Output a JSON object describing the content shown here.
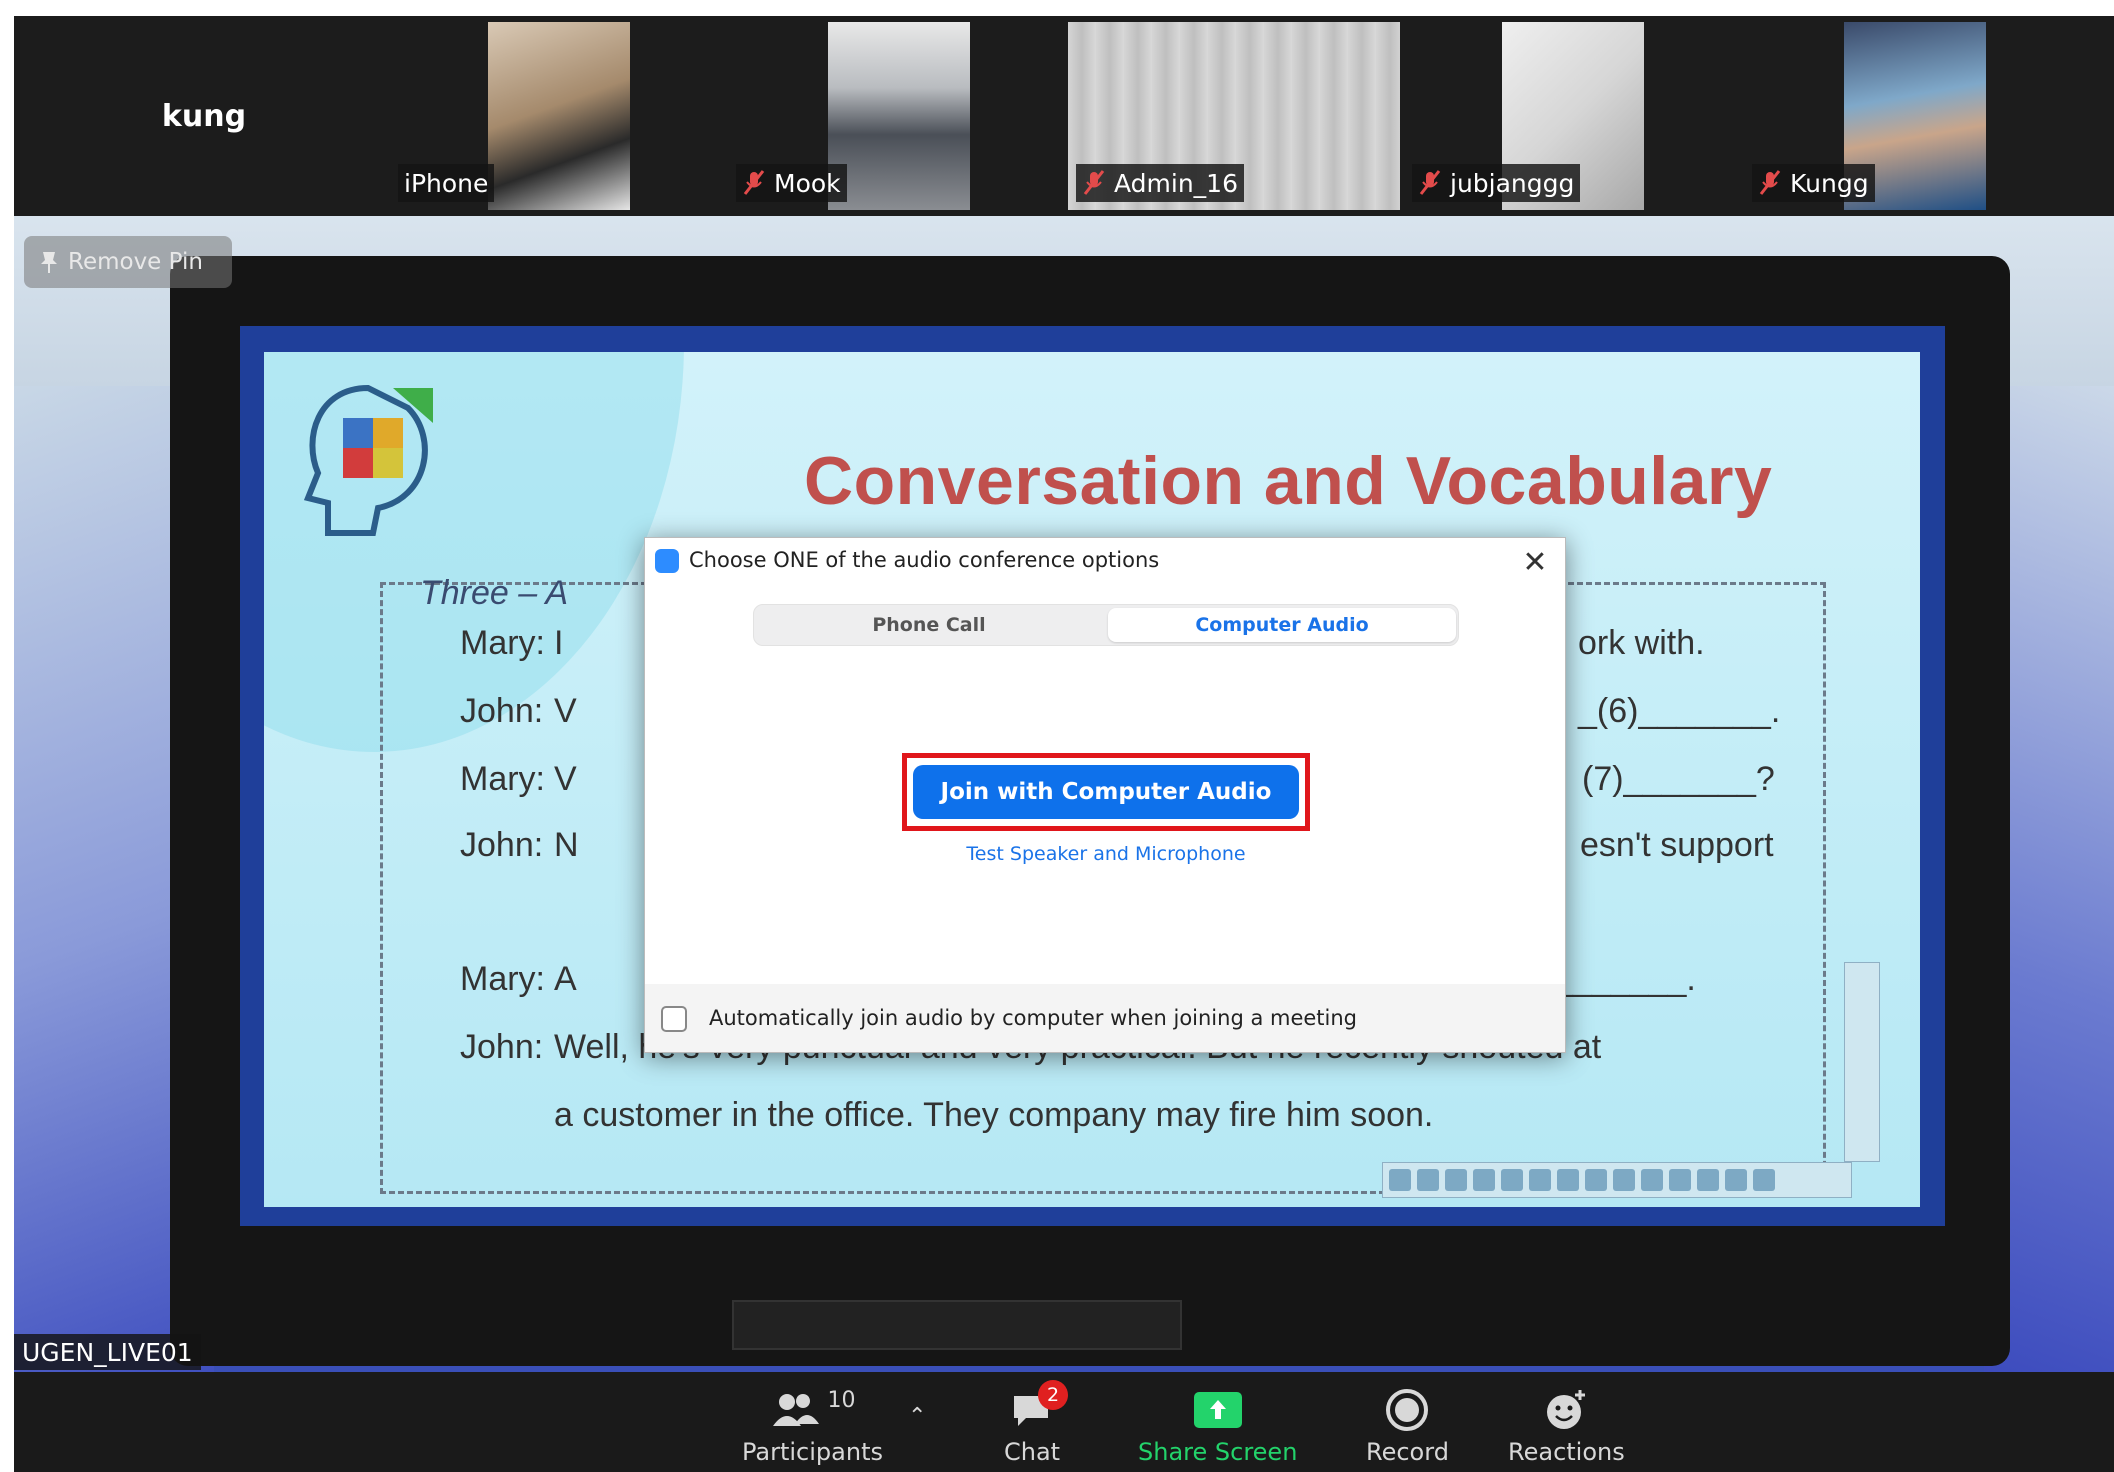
{
  "strip": {
    "name_tile": "kung",
    "participants": [
      {
        "name": "iPhone",
        "muted": false
      },
      {
        "name": "Mook",
        "muted": true
      },
      {
        "name": "Admin_16",
        "muted": true
      },
      {
        "name": "jubjanggg",
        "muted": true
      },
      {
        "name": "Kungg",
        "muted": true
      }
    ]
  },
  "main": {
    "remove_pin_label": "Remove Pin",
    "speaker_label": "UGEN_LIVE01",
    "slide": {
      "title": "Conversation and Vocabulary",
      "heading_partial": "Three – A",
      "lines": [
        {
          "speaker": "Mary:",
          "left": "I",
          "right": "ork with."
        },
        {
          "speaker": "John:",
          "left": "V",
          "right": "_(6)_______."
        },
        {
          "speaker": "Mary:",
          "left": "V",
          "right": "(7)_______?"
        },
        {
          "speaker": "John:",
          "left": "N",
          "right": "esn't support"
        },
        {
          "speaker": "Mary:",
          "left": "A",
          "right": "_______."
        },
        {
          "speaker": "John:",
          "text": "Well, he's very punctual and very practical. But he recently shouted at"
        },
        {
          "speaker": "",
          "text": "a customer in the office. They company may fire him soon."
        }
      ]
    }
  },
  "dialog": {
    "title": "Choose ONE of the audio conference options",
    "tabs": [
      "Phone Call",
      "Computer Audio"
    ],
    "active_tab": "Computer Audio",
    "join_button": "Join with Computer Audio",
    "test_link": "Test Speaker and Microphone",
    "auto_join_label": "Automatically join audio by computer when joining a meeting",
    "auto_join_checked": false
  },
  "toolbar": {
    "participants_count": "10",
    "participants_label": "Participants",
    "chat_label": "Chat",
    "chat_badge": "2",
    "share_label": "Share Screen",
    "record_label": "Record",
    "reactions_label": "Reactions"
  },
  "colors": {
    "join_button": "#0e71eb",
    "highlight_frame": "#e0161b",
    "share_green": "#23d36b",
    "slide_title": "#c0504d"
  }
}
